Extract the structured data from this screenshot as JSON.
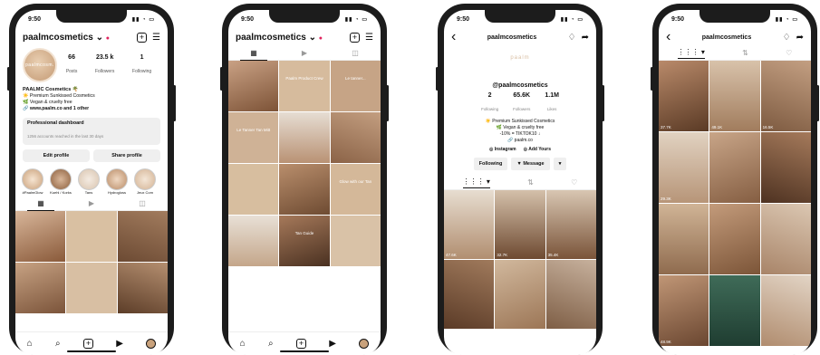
{
  "time": "9:50",
  "handle": "paalmcosmetics",
  "tiktok_title": "paalmcosmetics",
  "profile": {
    "avatar_text": "paalmcosm.",
    "stats": [
      {
        "value": "66",
        "label": "Posts"
      },
      {
        "value": "23.5 k",
        "label": "Followers"
      },
      {
        "value": "1",
        "label": "Following"
      }
    ],
    "name": "PAALMC Cosmetics 🌴",
    "bio_lines": [
      "☀️ Premium Sunkissed Cosmetics",
      "🌿 Vegan & cruelty free"
    ],
    "link": "🔗 www.paalm.co and 1 other",
    "dashboard_title": "Professional dashboard",
    "dashboard_sub": "1256 accounts reached in the last 30 days",
    "edit_profile": "Edit profile",
    "share_profile": "Share profile",
    "highlights": [
      "#PaalmGlow",
      "Kuehl / Korks",
      "Tans",
      "Hydrogloss",
      "Jeux Com"
    ]
  },
  "tiktok": {
    "logo": "paalm",
    "handle": "@paalmcosmetics",
    "stats": [
      {
        "value": "2",
        "label": "Following"
      },
      {
        "value": "65.6K",
        "label": "Followers"
      },
      {
        "value": "1.1M",
        "label": "Likes"
      }
    ],
    "bio_lines": [
      "☀️ Premium Sunkissed Cosmetics",
      "🌿 Vegan & cruelty free",
      "-10% = TIKTOK10 ↓",
      "🔗 paalm.co"
    ],
    "instagram": "Instagram",
    "add_yours": "Add Yours",
    "following_btn": "Following",
    "message_btn": "Message",
    "views": [
      "47.6K",
      "32.7K",
      "35.4K",
      "",
      "",
      ""
    ]
  },
  "videos4_views": [
    "37.7K",
    "49.1K",
    "16.5K",
    "29.3K",
    "",
    "",
    "",
    "",
    "",
    "48.9K",
    "",
    ""
  ],
  "captions2": [
    "",
    "Paalm Product Crew",
    "Le tanner...",
    "Le Tanner Tan Mitt",
    "",
    "",
    "",
    "Glow with our Tan",
    "",
    "Tan Guide",
    "",
    ""
  ]
}
